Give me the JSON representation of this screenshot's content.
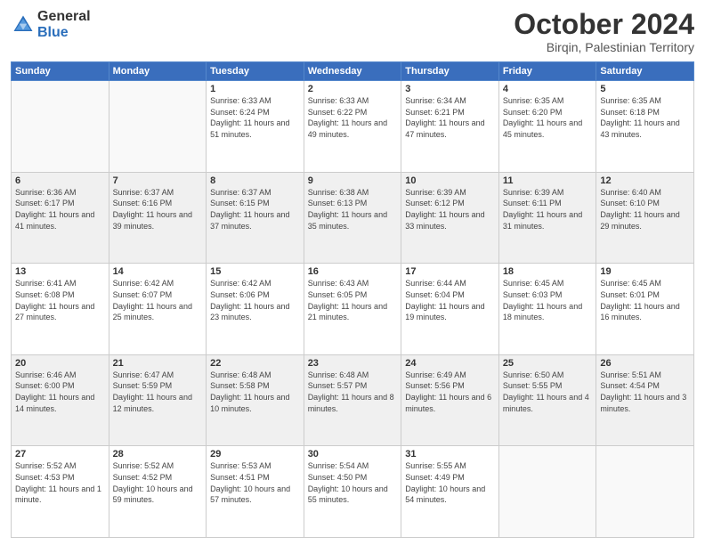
{
  "header": {
    "logo": {
      "general": "General",
      "blue": "Blue"
    },
    "title": "October 2024",
    "location": "Birqin, Palestinian Territory"
  },
  "weekdays": [
    "Sunday",
    "Monday",
    "Tuesday",
    "Wednesday",
    "Thursday",
    "Friday",
    "Saturday"
  ],
  "weeks": [
    [
      {
        "day": "",
        "sunrise": "",
        "sunset": "",
        "daylight": ""
      },
      {
        "day": "",
        "sunrise": "",
        "sunset": "",
        "daylight": ""
      },
      {
        "day": "1",
        "sunrise": "Sunrise: 6:33 AM",
        "sunset": "Sunset: 6:24 PM",
        "daylight": "Daylight: 11 hours and 51 minutes."
      },
      {
        "day": "2",
        "sunrise": "Sunrise: 6:33 AM",
        "sunset": "Sunset: 6:22 PM",
        "daylight": "Daylight: 11 hours and 49 minutes."
      },
      {
        "day": "3",
        "sunrise": "Sunrise: 6:34 AM",
        "sunset": "Sunset: 6:21 PM",
        "daylight": "Daylight: 11 hours and 47 minutes."
      },
      {
        "day": "4",
        "sunrise": "Sunrise: 6:35 AM",
        "sunset": "Sunset: 6:20 PM",
        "daylight": "Daylight: 11 hours and 45 minutes."
      },
      {
        "day": "5",
        "sunrise": "Sunrise: 6:35 AM",
        "sunset": "Sunset: 6:18 PM",
        "daylight": "Daylight: 11 hours and 43 minutes."
      }
    ],
    [
      {
        "day": "6",
        "sunrise": "Sunrise: 6:36 AM",
        "sunset": "Sunset: 6:17 PM",
        "daylight": "Daylight: 11 hours and 41 minutes."
      },
      {
        "day": "7",
        "sunrise": "Sunrise: 6:37 AM",
        "sunset": "Sunset: 6:16 PM",
        "daylight": "Daylight: 11 hours and 39 minutes."
      },
      {
        "day": "8",
        "sunrise": "Sunrise: 6:37 AM",
        "sunset": "Sunset: 6:15 PM",
        "daylight": "Daylight: 11 hours and 37 minutes."
      },
      {
        "day": "9",
        "sunrise": "Sunrise: 6:38 AM",
        "sunset": "Sunset: 6:13 PM",
        "daylight": "Daylight: 11 hours and 35 minutes."
      },
      {
        "day": "10",
        "sunrise": "Sunrise: 6:39 AM",
        "sunset": "Sunset: 6:12 PM",
        "daylight": "Daylight: 11 hours and 33 minutes."
      },
      {
        "day": "11",
        "sunrise": "Sunrise: 6:39 AM",
        "sunset": "Sunset: 6:11 PM",
        "daylight": "Daylight: 11 hours and 31 minutes."
      },
      {
        "day": "12",
        "sunrise": "Sunrise: 6:40 AM",
        "sunset": "Sunset: 6:10 PM",
        "daylight": "Daylight: 11 hours and 29 minutes."
      }
    ],
    [
      {
        "day": "13",
        "sunrise": "Sunrise: 6:41 AM",
        "sunset": "Sunset: 6:08 PM",
        "daylight": "Daylight: 11 hours and 27 minutes."
      },
      {
        "day": "14",
        "sunrise": "Sunrise: 6:42 AM",
        "sunset": "Sunset: 6:07 PM",
        "daylight": "Daylight: 11 hours and 25 minutes."
      },
      {
        "day": "15",
        "sunrise": "Sunrise: 6:42 AM",
        "sunset": "Sunset: 6:06 PM",
        "daylight": "Daylight: 11 hours and 23 minutes."
      },
      {
        "day": "16",
        "sunrise": "Sunrise: 6:43 AM",
        "sunset": "Sunset: 6:05 PM",
        "daylight": "Daylight: 11 hours and 21 minutes."
      },
      {
        "day": "17",
        "sunrise": "Sunrise: 6:44 AM",
        "sunset": "Sunset: 6:04 PM",
        "daylight": "Daylight: 11 hours and 19 minutes."
      },
      {
        "day": "18",
        "sunrise": "Sunrise: 6:45 AM",
        "sunset": "Sunset: 6:03 PM",
        "daylight": "Daylight: 11 hours and 18 minutes."
      },
      {
        "day": "19",
        "sunrise": "Sunrise: 6:45 AM",
        "sunset": "Sunset: 6:01 PM",
        "daylight": "Daylight: 11 hours and 16 minutes."
      }
    ],
    [
      {
        "day": "20",
        "sunrise": "Sunrise: 6:46 AM",
        "sunset": "Sunset: 6:00 PM",
        "daylight": "Daylight: 11 hours and 14 minutes."
      },
      {
        "day": "21",
        "sunrise": "Sunrise: 6:47 AM",
        "sunset": "Sunset: 5:59 PM",
        "daylight": "Daylight: 11 hours and 12 minutes."
      },
      {
        "day": "22",
        "sunrise": "Sunrise: 6:48 AM",
        "sunset": "Sunset: 5:58 PM",
        "daylight": "Daylight: 11 hours and 10 minutes."
      },
      {
        "day": "23",
        "sunrise": "Sunrise: 6:48 AM",
        "sunset": "Sunset: 5:57 PM",
        "daylight": "Daylight: 11 hours and 8 minutes."
      },
      {
        "day": "24",
        "sunrise": "Sunrise: 6:49 AM",
        "sunset": "Sunset: 5:56 PM",
        "daylight": "Daylight: 11 hours and 6 minutes."
      },
      {
        "day": "25",
        "sunrise": "Sunrise: 6:50 AM",
        "sunset": "Sunset: 5:55 PM",
        "daylight": "Daylight: 11 hours and 4 minutes."
      },
      {
        "day": "26",
        "sunrise": "Sunrise: 5:51 AM",
        "sunset": "Sunset: 4:54 PM",
        "daylight": "Daylight: 11 hours and 3 minutes."
      }
    ],
    [
      {
        "day": "27",
        "sunrise": "Sunrise: 5:52 AM",
        "sunset": "Sunset: 4:53 PM",
        "daylight": "Daylight: 11 hours and 1 minute."
      },
      {
        "day": "28",
        "sunrise": "Sunrise: 5:52 AM",
        "sunset": "Sunset: 4:52 PM",
        "daylight": "Daylight: 10 hours and 59 minutes."
      },
      {
        "day": "29",
        "sunrise": "Sunrise: 5:53 AM",
        "sunset": "Sunset: 4:51 PM",
        "daylight": "Daylight: 10 hours and 57 minutes."
      },
      {
        "day": "30",
        "sunrise": "Sunrise: 5:54 AM",
        "sunset": "Sunset: 4:50 PM",
        "daylight": "Daylight: 10 hours and 55 minutes."
      },
      {
        "day": "31",
        "sunrise": "Sunrise: 5:55 AM",
        "sunset": "Sunset: 4:49 PM",
        "daylight": "Daylight: 10 hours and 54 minutes."
      },
      {
        "day": "",
        "sunrise": "",
        "sunset": "",
        "daylight": ""
      },
      {
        "day": "",
        "sunrise": "",
        "sunset": "",
        "daylight": ""
      }
    ]
  ]
}
